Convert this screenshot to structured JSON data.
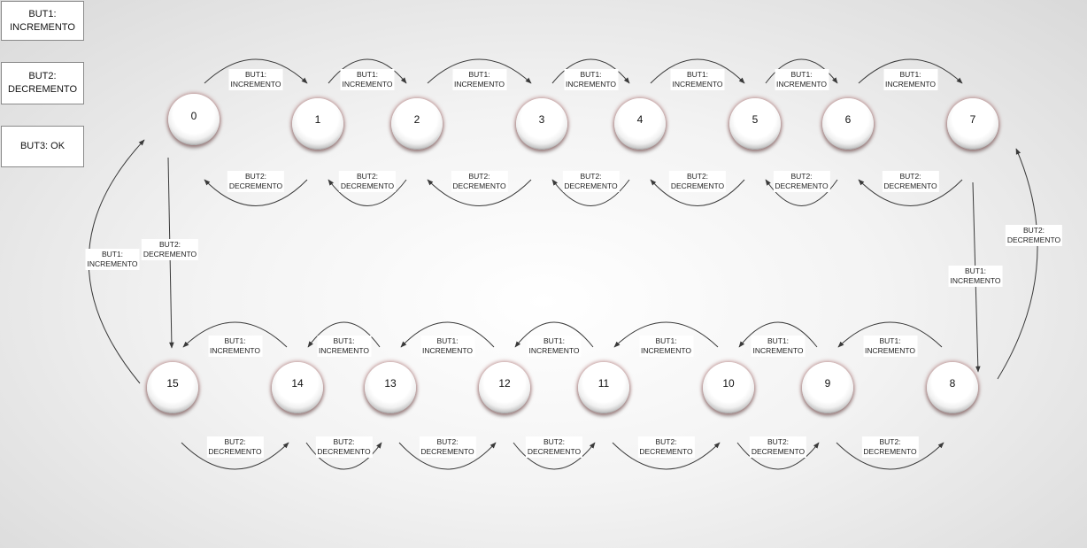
{
  "colors": {
    "arrow": "#3a3a3a",
    "node_shadow": "#8b3a3a",
    "box_border": "#8a8a8a"
  },
  "legend": [
    {
      "text": "BUT1:\nINCREMENTO"
    },
    {
      "text": "BUT2:\nDECREMENTO"
    },
    {
      "text": "BUT3: OK"
    }
  ],
  "labels": {
    "inc": "BUT1:\nINCREMENTO",
    "dec": "BUT2:\nDECREMENTO"
  },
  "states": [
    "0",
    "1",
    "2",
    "3",
    "4",
    "5",
    "6",
    "7",
    "8",
    "9",
    "10",
    "11",
    "12",
    "13",
    "14",
    "15"
  ]
}
